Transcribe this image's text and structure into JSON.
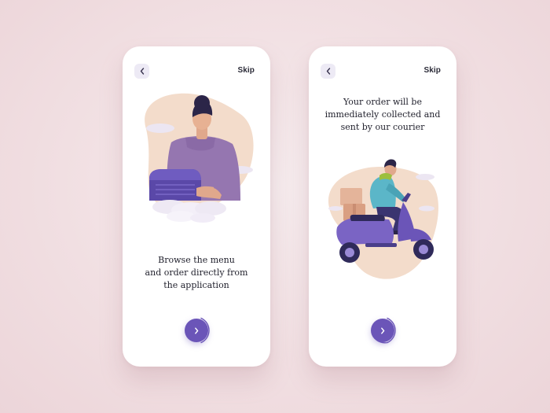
{
  "colors": {
    "background": "#f1dfe2",
    "card": "#ffffff",
    "accent": "#6b55b8",
    "back_button_bg": "#edeaf5",
    "text": "#22222e"
  },
  "screens": [
    {
      "back_icon": "chevron-left-icon",
      "skip_label": "Skip",
      "message_lines": [
        "Browse the menu",
        "and order directly from",
        "the application"
      ],
      "illustration": "person-holding-delivery-box",
      "next_icon": "chevron-right-icon"
    },
    {
      "back_icon": "chevron-left-icon",
      "skip_label": "Skip",
      "message_lines": [
        "Your order will be",
        "immediately collected and",
        "sent by our courier"
      ],
      "illustration": "courier-on-scooter",
      "next_icon": "chevron-right-icon"
    }
  ]
}
